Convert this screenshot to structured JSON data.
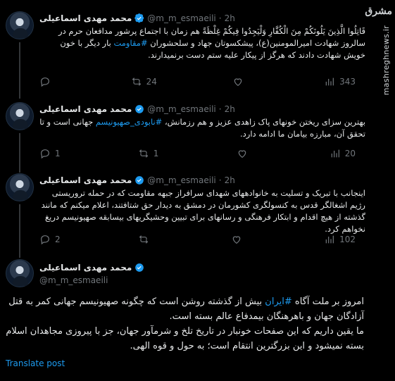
{
  "account": {
    "name": "محمد مهدی اسماعیلی",
    "handle": "@m_m_esmaeili",
    "handle_short": "@m_m_esmaeili · 2h"
  },
  "tweets": [
    {
      "time": "2h",
      "text_before": "قَاتِلُوا الَّذِينَ يَلُونَكُمْ مِنَ الْكُفَّارِ وَلْيَجِدُوا فِيكُمْ غِلْظَةً هم زمان با اجتماع پرشور مدافعان حرم در سالروز شهادت امیرالمومنین(ع)، پیشکسوتان جهاد و سلحشوران ",
      "hashtag": "#مقاومت",
      "text_after": " بار دیگر با خون خویش شهادت دادند که هرگز از پیکار علیه ستم دست برنمیدارند.",
      "replies": "",
      "retweets": "24",
      "likes": "",
      "views": "343"
    },
    {
      "time": "2h",
      "text_before": "بهترین سزای ریختن خونهای پاک زاهدی عزیز و هم رزمانش، ",
      "hashtag": "#نابودی_صهیونیسم",
      "text_after": " جهانی است و تا تحقق آن، مبارزه بیامان ما ادامه دارد.",
      "replies": "1",
      "retweets": "1",
      "likes": "",
      "views": "20"
    },
    {
      "time": "2h",
      "text_before": "اینجانب با تبریک و تسلیت به خانوادههای شهدای سرافراز جبهه مقاومت که در حمله تروریستی رژیم اشغالگر قدس به کنسولگری کشورمان در دمشق به دیدار حق شتافتند، اعلام میکنم که مانند گذشته از هیچ اقدام و ابتکار فرهنگی و رسانهای برای تبیین وحشیگریهای بیسابقه صهیونیسم دریغ نخواهم کرد.",
      "hashtag": "",
      "text_after": "",
      "replies": "2",
      "retweets": "",
      "likes": "",
      "views": "102"
    }
  ],
  "main_post": {
    "line1_before": "امروز بر ملت آگاه ",
    "hashtag": "#ایران",
    "line1_after": " بیش از گذشته روشن است که چگونه صهیونیسم جهانی کمر به قتل آزادگان جهان و باهرهنگان بیمدفاع عالم بسته است.",
    "line2": "ما یقین داریم که این صفحات خونبار در تاریخ تلخ و شرمآور جهان، جز با پیروزی مجاهدان اسلام بسته نمیشود و این بزرگترین انتقام است؛ به حول و قوه الهی.",
    "translate": "Translate post"
  },
  "watermark": {
    "logo": "مشرق",
    "site": "mashreghnews.ir"
  },
  "colors": {
    "background": "#000000",
    "text": "#e7e9ea",
    "muted": "#71767b",
    "link": "#1d9bf0",
    "verified": "#1d9bf0"
  }
}
